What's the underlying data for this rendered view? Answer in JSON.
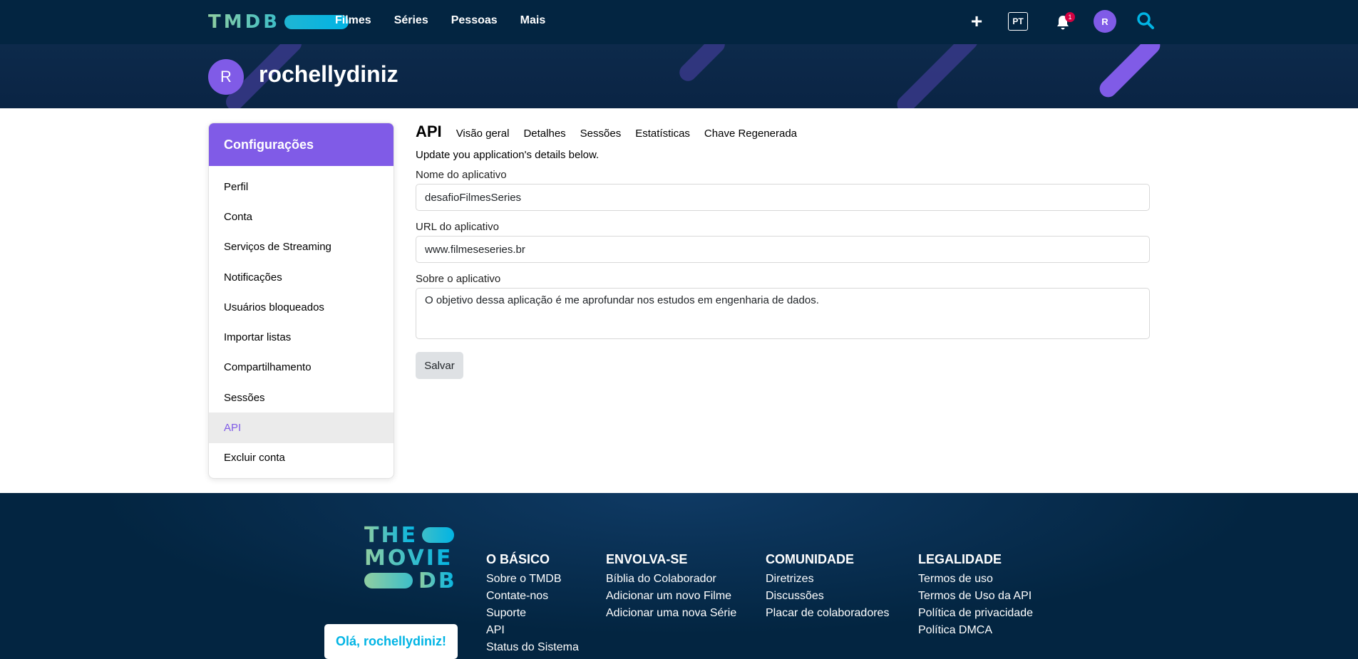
{
  "nav": {
    "logo": "TMDB",
    "links": [
      "Filmes",
      "Séries",
      "Pessoas",
      "Mais"
    ],
    "lang": "PT",
    "notifications": "1",
    "avatar_initial": "R"
  },
  "profile": {
    "initial": "R",
    "username": "rochellydiniz"
  },
  "sidebar": {
    "title": "Configurações",
    "items": [
      "Perfil",
      "Conta",
      "Serviços de Streaming",
      "Notificações",
      "Usuários bloqueados",
      "Importar listas",
      "Compartilhamento",
      "Sessões",
      "API",
      "Excluir conta"
    ],
    "active": "API"
  },
  "main": {
    "title": "API",
    "tabs": [
      "Visão geral",
      "Detalhes",
      "Sessões",
      "Estatísticas",
      "Chave Regenerada"
    ],
    "intro": "Update you application's details below.",
    "app_name_label": "Nome do aplicativo",
    "app_name_value": "desafioFilmesSeries",
    "app_url_label": "URL do aplicativo",
    "app_url_value": "www.filmeseseries.br",
    "about_label": "Sobre o aplicativo",
    "about_value": "O objetivo dessa aplicação é me aprofundar nos estudos em engenharia de dados.",
    "save_label": "Salvar"
  },
  "footer": {
    "logo_lines": [
      "THE",
      "MOVIE",
      "DB"
    ],
    "hello": "Olá, rochellydiniz!",
    "columns": [
      {
        "title": "O BÁSICO",
        "links": [
          "Sobre o TMDB",
          "Contate-nos",
          "Suporte",
          "API",
          "Status do Sistema"
        ]
      },
      {
        "title": "ENVOLVA-SE",
        "links": [
          "Bíblia do Colaborador",
          "Adicionar um novo Filme",
          "Adicionar uma nova Série"
        ]
      },
      {
        "title": "COMUNIDADE",
        "links": [
          "Diretrizes",
          "Discussões",
          "Placar de colaboradores"
        ]
      },
      {
        "title": "LEGALIDADE",
        "links": [
          "Termos de uso",
          "Termos de Uso da API",
          "Política de privacidade",
          "Política DMCA"
        ]
      }
    ]
  },
  "colors": {
    "nav_bg": "#032541",
    "accent_purple": "#805be7",
    "brand_teal": "#01b4e4",
    "badge_red": "#d40242"
  }
}
